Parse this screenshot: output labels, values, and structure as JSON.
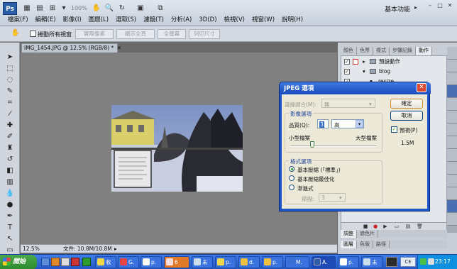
{
  "app": {
    "logo": "Ps",
    "zoom": "100%",
    "workspace": "基本功能"
  },
  "menu": [
    "檔案(F)",
    "編輯(E)",
    "影像(I)",
    "圖層(L)",
    "選取(S)",
    "濾鏡(T)",
    "分析(A)",
    "3D(D)",
    "檢視(V)",
    "視窗(W)",
    "說明(H)"
  ],
  "options": {
    "scroll_all": "捲動所有視窗",
    "buttons": [
      "實際像素",
      "顯示全頁",
      "全螢幕",
      "列印尺寸"
    ]
  },
  "document": {
    "tab_title": "IMG_1454.JPG @ 12.5% (RGB/8) *",
    "zoom": "12.5%",
    "file_info": "文件: 10.8M/10.8M"
  },
  "panels": {
    "tabs": [
      "顏色",
      "色票",
      "樣式",
      "步驟記錄",
      "動作"
    ],
    "active_tab": "動作",
    "actions": [
      {
        "label": "預設動作",
        "checked": true,
        "type": "folder"
      },
      {
        "label": "blog",
        "checked": true,
        "type": "folder"
      },
      {
        "label": "resize",
        "checked": true,
        "type": "action"
      }
    ],
    "bottom_tabs_1": [
      "調整",
      "遮色片"
    ],
    "bottom_tabs_2": [
      "圖層",
      "色版",
      "路徑"
    ]
  },
  "dialog": {
    "title": "JPEG 選項",
    "matte_label": "邊緣調合(M):",
    "matte_value": "無",
    "image_options_title": "影像選項",
    "quality_label": "品質(Q):",
    "quality_value": "3",
    "quality_level": "高",
    "small_file": "小型檔案",
    "large_file": "大型檔案",
    "slider_fraction": 0.25,
    "format_title": "格式選項",
    "formats": [
      "基本壓縮 (「標準」)",
      "基本壓縮最佳化",
      "漸進式"
    ],
    "selected_format": 0,
    "scans_label": "掃描:",
    "scans_value": "3",
    "ok": "確定",
    "cancel": "取消",
    "preview_label": "預視(P)",
    "preview_checked": true,
    "file_size": "1.5M"
  },
  "taskbar": {
    "start": "開始",
    "tasks": [
      "收",
      "G.",
      "p.",
      "6",
      "未",
      "p.",
      "d.",
      "p.",
      "M.",
      "A.",
      "p.",
      "未"
    ],
    "active_task_index": 9,
    "tray_label": "CE",
    "clock": "23:17"
  }
}
